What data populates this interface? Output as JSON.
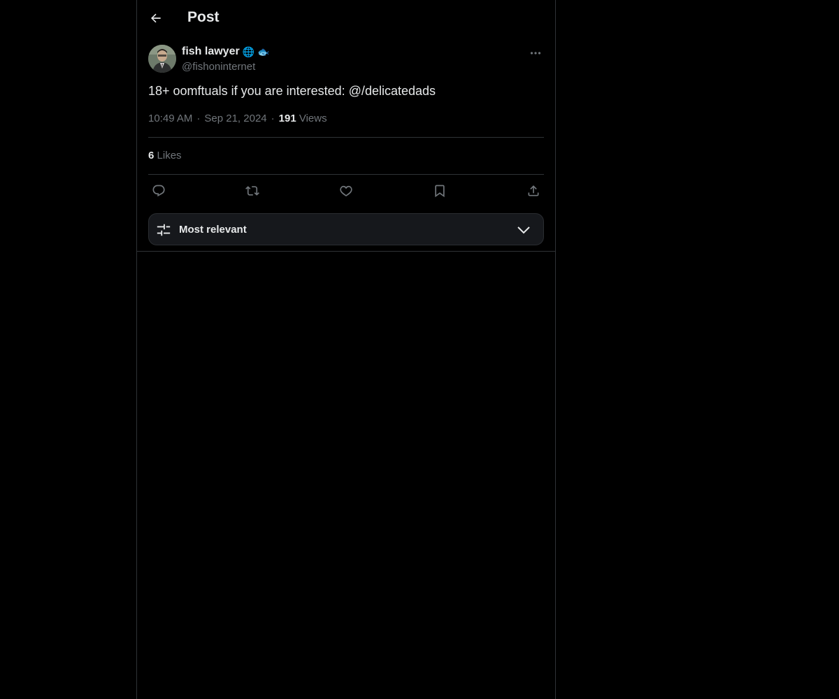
{
  "header": {
    "title": "Post",
    "back_icon": "arrow-left-icon"
  },
  "author": {
    "display_name": "fish lawyer",
    "name_emojis": [
      "🌐",
      "🐟"
    ],
    "handle": "@fishoninternet",
    "avatar_icon": "avatar"
  },
  "post": {
    "text": "18+ oomftuals if you are interested: @/delicatedads",
    "time": "10:49 AM",
    "date": "Sep 21, 2024",
    "views_count": "191",
    "views_label": "Views",
    "separator": "·"
  },
  "engagement": {
    "likes_count": "6",
    "likes_label": "Likes"
  },
  "actions": {
    "reply": "reply-icon",
    "repost": "repost-icon",
    "like": "heart-icon",
    "bookmark": "bookmark-icon",
    "share": "share-icon"
  },
  "sort": {
    "label": "Most relevant"
  },
  "colors": {
    "background": "#000000",
    "text_primary": "#e7e9ea",
    "text_secondary": "#71767b",
    "border": "#2f3336",
    "panel": "#16181c"
  }
}
